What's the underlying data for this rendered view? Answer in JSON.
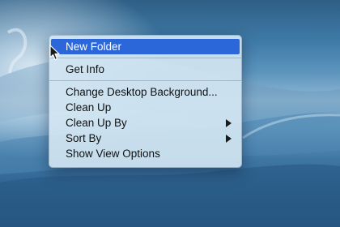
{
  "context_menu": {
    "items": [
      {
        "label": "New Folder",
        "selected": true
      },
      {
        "label": "Get Info"
      },
      {
        "label": "Change Desktop Background..."
      },
      {
        "label": "Clean Up"
      },
      {
        "label": "Clean Up By",
        "submenu": true
      },
      {
        "label": "Sort By",
        "submenu": true
      },
      {
        "label": "Show View Options"
      }
    ],
    "highlight_color": "#2b67d8"
  },
  "icons": {
    "pointer": "arrow-cursor-icon",
    "submenu": "chevron-right-icon"
  }
}
